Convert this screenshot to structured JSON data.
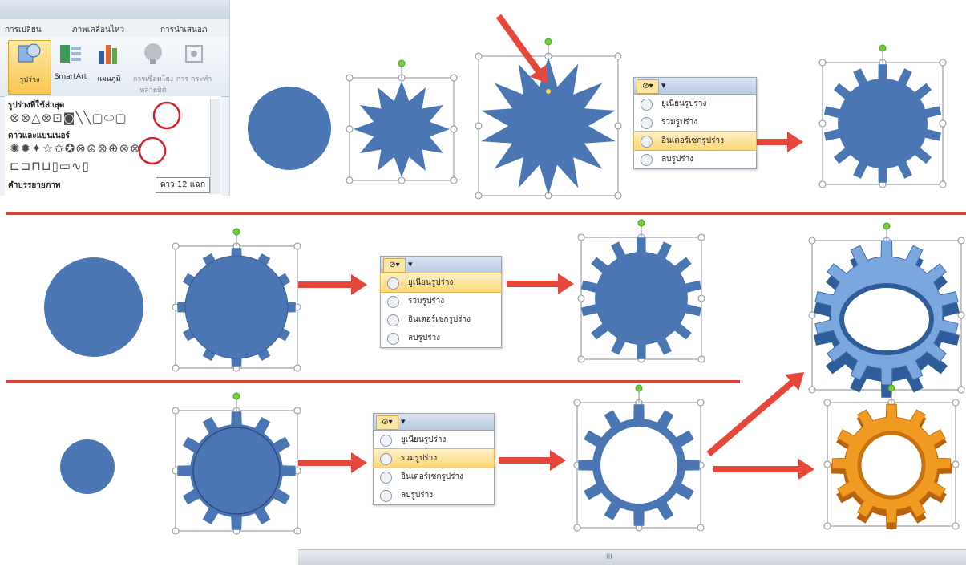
{
  "ribbon": {
    "tabs": [
      "การเปลี่ยน",
      "ภาพเคลื่อนไหว",
      "การนำเสนอภ"
    ],
    "buttons": [
      {
        "label": "รูปร่าง",
        "icon": "shapes-icon",
        "selected": true
      },
      {
        "label": "SmartArt",
        "icon": "smartart-icon",
        "selected": false
      },
      {
        "label": "แผนภูมิ",
        "icon": "chart-icon",
        "selected": false
      },
      {
        "label": "การเชื่อมโยง หลายมิติ",
        "icon": "hyperlink-icon",
        "selected": false,
        "disabled": true
      },
      {
        "label": "การ กระทำ",
        "icon": "action-icon",
        "selected": false,
        "disabled": true
      }
    ],
    "gallery": {
      "recent_header": "รูปร่างที่ใช้ล่าสุด",
      "recent_row": "⊗⊗△⊗⊡◙╲╲▢⬭▢",
      "stars_header": "ดาวและแบนเนอร์",
      "stars_row": "✺✹✦☆✩✪⊗⊛⊗⊕⊗⊗",
      "banner_row": "⊏⊐⊓⊔▯▭∿▯",
      "callouts_header": "คำบรรยายภาพ"
    },
    "tooltip": "ดาว 12 แฉก"
  },
  "menu": {
    "items": [
      "ยูเนียนรูปร่าง",
      "รวมรูปร่าง",
      "อินเตอร์เซกรูปร่าง",
      "ลบรูปร่าง"
    ],
    "menu1_highlight": 2,
    "menu2_highlight": 0,
    "menu3_highlight": 1
  },
  "colors": {
    "shape_blue": "#4a76b4",
    "arrow_red": "#e5473b",
    "divider_red": "#d9423a",
    "gear_light_blue": "#7aa7dd",
    "gear_orange": "#f09a21",
    "handle_green": "#6fcf3b"
  }
}
